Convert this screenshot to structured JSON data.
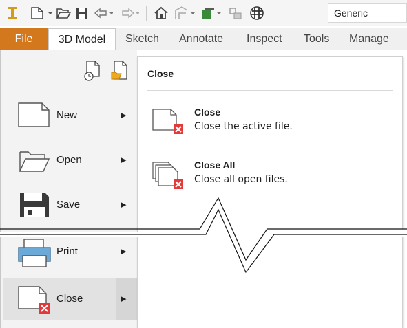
{
  "qat": {
    "buttons": [
      "app-logo-icon",
      "new-file-icon",
      "open-folder-icon",
      "save-icon",
      "undo-icon",
      "redo-icon",
      "home-icon",
      "home-view-icon",
      "visibility-icon",
      "appearance-icon",
      "material-icon"
    ],
    "material_value": "Generic"
  },
  "ribbon": {
    "tabs": [
      "File",
      "3D Model",
      "Sketch",
      "Annotate",
      "Inspect",
      "Tools",
      "Manage"
    ]
  },
  "file_menu": {
    "recent_icons": [
      "recent-documents-icon",
      "open-recent-icon"
    ],
    "items": [
      {
        "label": "New",
        "icon": "new-document-icon"
      },
      {
        "label": "Open",
        "icon": "open-folder-icon"
      },
      {
        "label": "Save",
        "icon": "floppy-disk-icon"
      },
      {
        "label": "Print",
        "icon": "printer-icon"
      },
      {
        "label": "Close",
        "icon": "close-document-icon"
      }
    ],
    "active_item": "Close"
  },
  "flyout": {
    "title": "Close",
    "items": [
      {
        "title": "Close",
        "description": "Close the active file.",
        "icon": "close-document-icon"
      },
      {
        "title": "Close All",
        "description": "Close all open files.",
        "icon": "close-all-documents-icon"
      }
    ]
  },
  "colors": {
    "file_tab": "#d4781e",
    "close_badge": "#e23a3a",
    "menu_bg": "#f3f3f3"
  }
}
